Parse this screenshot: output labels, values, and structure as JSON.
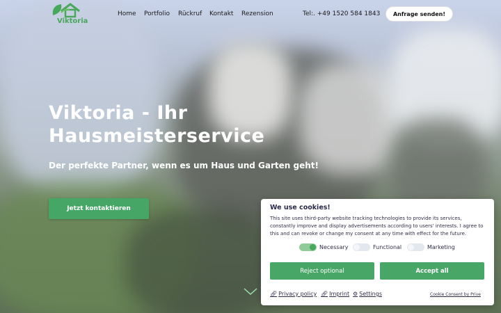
{
  "brand": {
    "name": "Viktoria",
    "accent": "#47a75b"
  },
  "nav": {
    "items": [
      "Home",
      "Portfolio",
      "Rückruf",
      "Kontakt",
      "Rezension"
    ],
    "phone": "Tel:. +49 1520 584 1843",
    "inquiry_label": "Anfrage senden!"
  },
  "hero": {
    "title": "Viktoria - Ihr Hausmeisterservice",
    "subtitle": "Der perfekte Partner, wenn es um Haus und Garten geht!",
    "cta_label": "Jetzt kontaktieren"
  },
  "cookie": {
    "title": "We use cookies!",
    "text": "This site uses third-party website tracking technologies to provide its services, constantly improve and display advertisements according to users' interests. I agree to this and can revoke or change my consent at any time with effect for the future.",
    "toggles": [
      {
        "label": "Necessary",
        "on": true
      },
      {
        "label": "Functional",
        "on": false
      },
      {
        "label": "Marketing",
        "on": false
      }
    ],
    "reject_label": "Reject optional",
    "accept_label": "Accept all",
    "links": [
      {
        "icon": "link-icon",
        "label": "Privacy policy"
      },
      {
        "icon": "link-icon",
        "label": "Imprint"
      },
      {
        "icon": "gear-icon",
        "label": "Settings"
      }
    ],
    "credit": "Cookie Consent by Prive"
  }
}
